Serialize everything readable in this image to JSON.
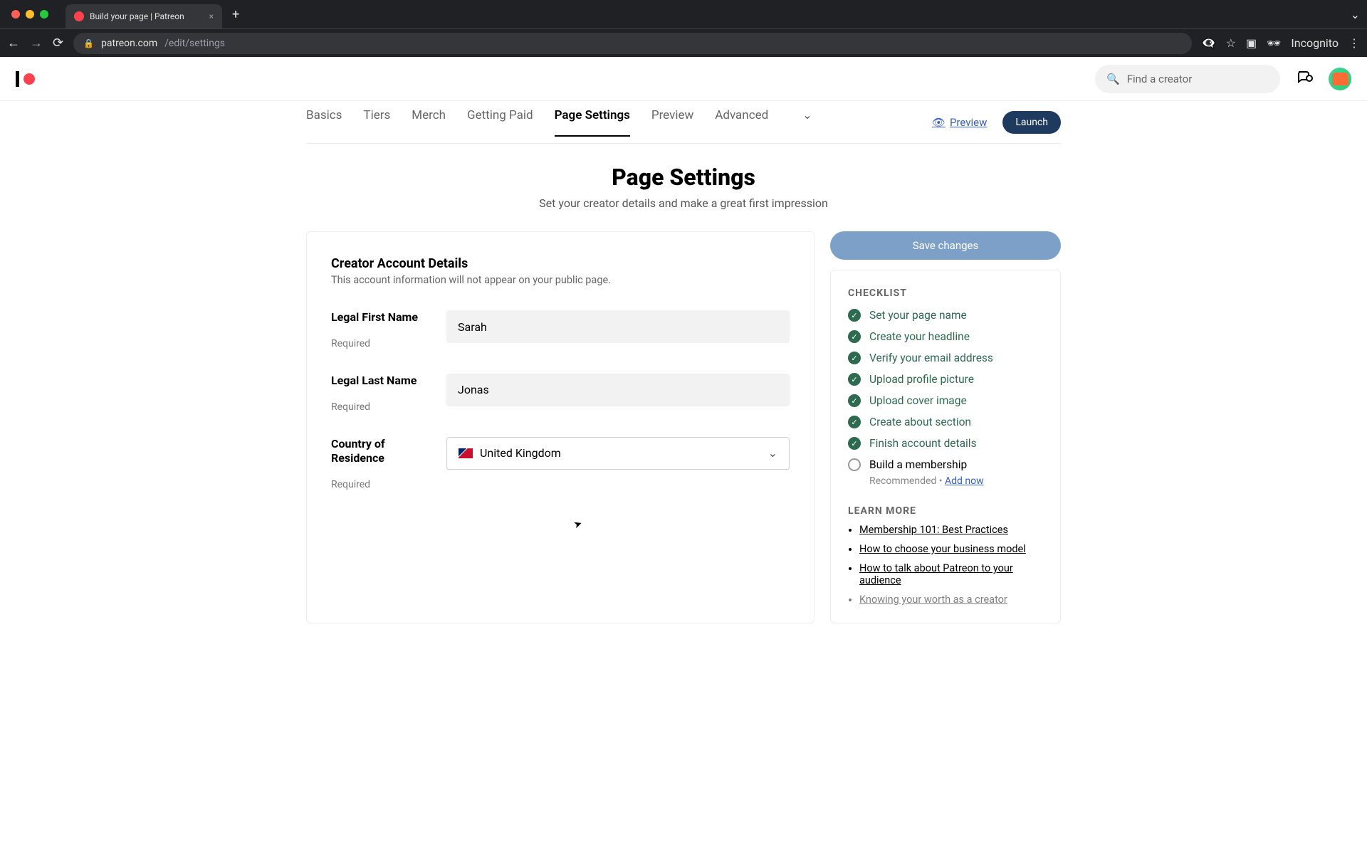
{
  "browser": {
    "tab_title": "Build your page | Patreon",
    "url_host": "patreon.com",
    "url_path": "/edit/settings",
    "incognito_label": "Incognito"
  },
  "header": {
    "search_placeholder": "Find a creator"
  },
  "tabs": {
    "items": [
      {
        "label": "Basics"
      },
      {
        "label": "Tiers"
      },
      {
        "label": "Merch"
      },
      {
        "label": "Getting Paid"
      },
      {
        "label": "Page Settings"
      },
      {
        "label": "Preview"
      },
      {
        "label": "Advanced"
      }
    ],
    "preview_link": "Preview",
    "launch_label": "Launch"
  },
  "page": {
    "title": "Page Settings",
    "subtitle": "Set your creator details and make a great first impression"
  },
  "form": {
    "section_title": "Creator Account Details",
    "section_note": "This account information will not appear on your public page.",
    "first_name": {
      "label": "Legal First Name",
      "value": "Sarah",
      "required": "Required"
    },
    "last_name": {
      "label": "Legal Last Name",
      "value": "Jonas",
      "required": "Required"
    },
    "country": {
      "label": "Country of Residence",
      "value": "United Kingdom",
      "required": "Required"
    }
  },
  "sidebar": {
    "save_label": "Save changes",
    "checklist_title": "CHECKLIST",
    "checklist": [
      {
        "label": "Set your page name",
        "done": true
      },
      {
        "label": "Create your headline",
        "done": true
      },
      {
        "label": "Verify your email address",
        "done": true
      },
      {
        "label": "Upload profile picture",
        "done": true
      },
      {
        "label": "Upload cover image",
        "done": true
      },
      {
        "label": "Create about section",
        "done": true
      },
      {
        "label": "Finish account details",
        "done": true
      },
      {
        "label": "Build a membership",
        "done": false,
        "sub_text": "Recommended •",
        "sub_link": "Add now"
      }
    ],
    "learn_more_title": "LEARN MORE",
    "learn_more": [
      "Membership 101: Best Practices",
      "How to choose your business model",
      "How to talk about Patreon to your audience",
      "Knowing your worth as a creator"
    ]
  }
}
